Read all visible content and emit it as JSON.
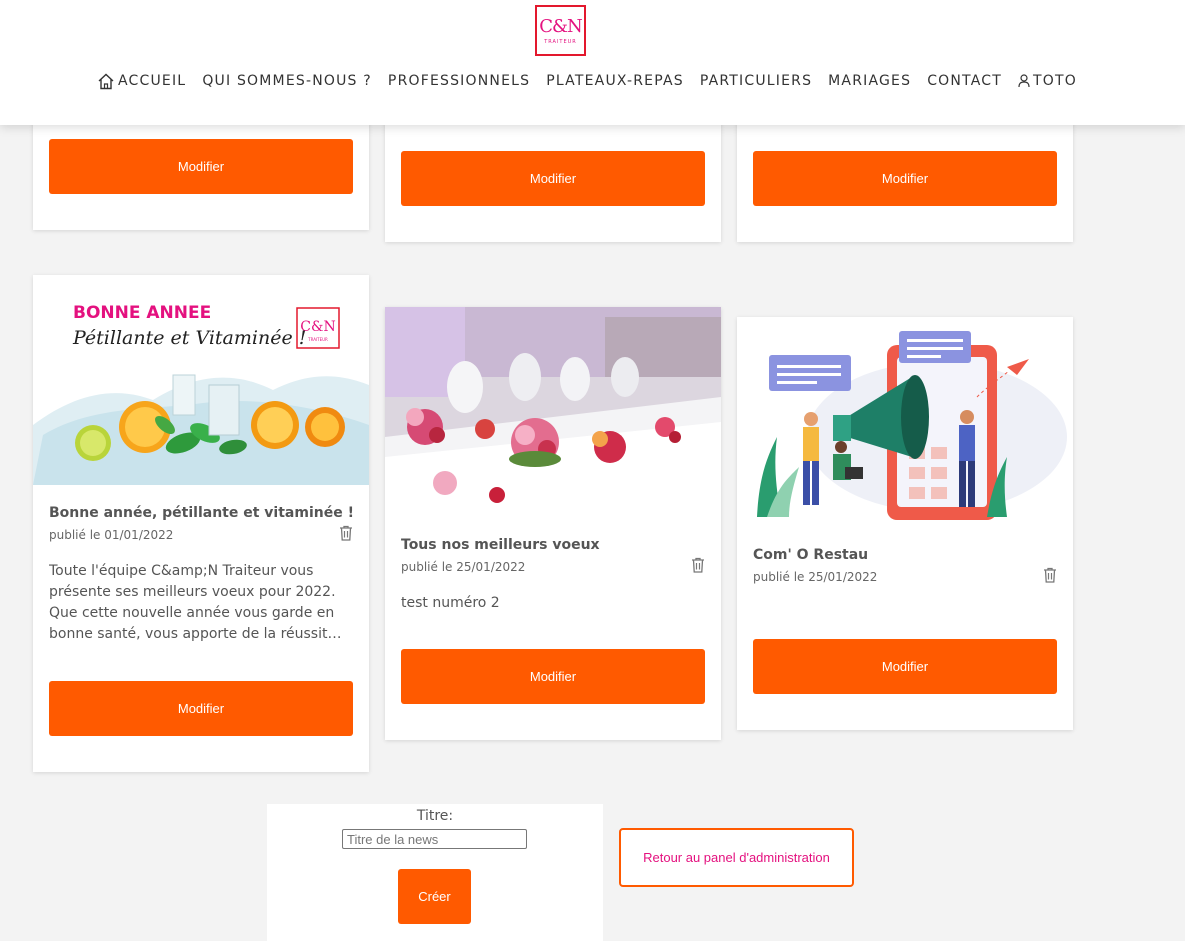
{
  "header": {
    "logo": {
      "monogram": "C&N",
      "subtitle": "TRAITEUR"
    },
    "nav": [
      {
        "label": "ACCUEIL",
        "icon": "home-icon"
      },
      {
        "label": "QUI SOMMES-NOUS ?"
      },
      {
        "label": "PROFESSIONNELS"
      },
      {
        "label": "PLATEAUX-REPAS"
      },
      {
        "label": "PARTICULIERS"
      },
      {
        "label": "MARIAGES"
      },
      {
        "label": "CONTACT"
      },
      {
        "label": "TOTO",
        "icon": "user-icon"
      }
    ]
  },
  "top_cards": [
    {
      "button": "Modifier"
    },
    {
      "button": "Modifier"
    },
    {
      "button": "Modifier"
    }
  ],
  "news": [
    {
      "image_text_1": "BONNE ANNEE",
      "image_text_2": "Pétillante et Vitaminée !",
      "title": "Bonne année, pétillante et vitaminée !",
      "date": "publié le 01/01/2022",
      "text": "Toute l'équipe C&amp;N Traiteur vous présente ses meilleurs voeux pour 2022. Que cette nouvelle année vous garde en bonne santé, vous apporte de la réussit…",
      "button": "Modifier"
    },
    {
      "title": "Tous nos meilleurs voeux",
      "date": "publié le 25/01/2022",
      "text": "test numéro 2",
      "button": "Modifier"
    },
    {
      "title": "Com' O Restau",
      "date": "publié le 25/01/2022",
      "text": "",
      "button": "Modifier"
    }
  ],
  "form": {
    "label": "Titre:",
    "placeholder": "Titre de la news",
    "create": "Créer"
  },
  "back_button": "Retour au panel d'administration",
  "colors": {
    "accent": "#ff5a00",
    "brand_pink": "#e4117f"
  }
}
